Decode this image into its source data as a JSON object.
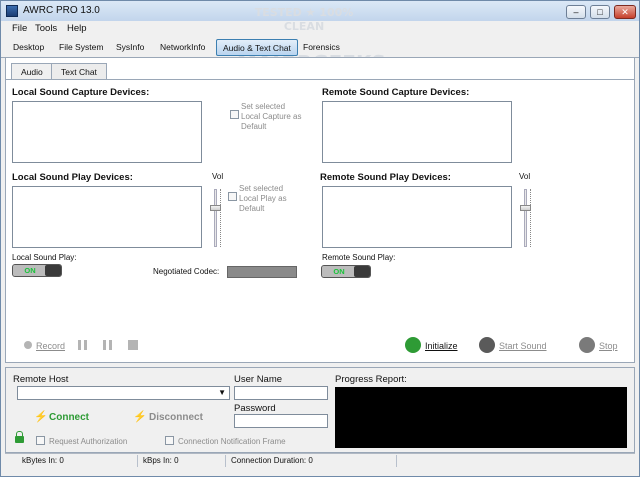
{
  "window": {
    "title": "AWRC PRO 13.0",
    "min": "–",
    "max": "□",
    "close": "✕"
  },
  "watermark": {
    "line1": "TESTED ★ 100% CLEAN",
    "line2": "MAJORGEEKS",
    "line3": "★ ★ ★ ★ ★ ★"
  },
  "menu": [
    "File",
    "Tools",
    "Help"
  ],
  "tabs": [
    "Desktop",
    "File System",
    "SysInfo",
    "NetworkInfo",
    "Audio & Text Chat",
    "Forensics"
  ],
  "subtabs": [
    "Audio",
    "Text Chat"
  ],
  "audio": {
    "local_capture_heading": "Local Sound Capture Devices:",
    "remote_capture_heading": "Remote Sound Capture Devices:",
    "local_play_heading": "Local Sound Play Devices:",
    "remote_play_heading": "Remote Sound Play Devices:",
    "set_capture_label": [
      "Set selected",
      "Local Capture as",
      "Default"
    ],
    "set_play_label": [
      "Set selected",
      "Local Play as",
      "Default"
    ],
    "vol": "Vol",
    "local_sound_play": "Local Sound Play:",
    "remote_sound_play": "Remote Sound Play:",
    "toggle_on": "ON",
    "negotiated_codec": "Negotiated Codec:",
    "record": "Record",
    "initialize": "Initialize",
    "start_sound": "Start Sound",
    "stop": "Stop"
  },
  "connection": {
    "remote_host": "Remote Host",
    "user_name": "User Name",
    "password": "Password",
    "progress_report": "Progress Report:",
    "connect": "Connect",
    "disconnect": "Disconnect",
    "request_authorization": "Request Authorization",
    "connection_notification_frame": "Connection Notification Frame"
  },
  "status": {
    "kbytes_in": "kBytes In:  0",
    "kbps_in": "kBps In:  0",
    "duration": "Connection Duration:  0"
  },
  "colors": {
    "accent": "#3c7fb1",
    "toggle_on": "#19c33a",
    "progress_bg": "#000000"
  }
}
